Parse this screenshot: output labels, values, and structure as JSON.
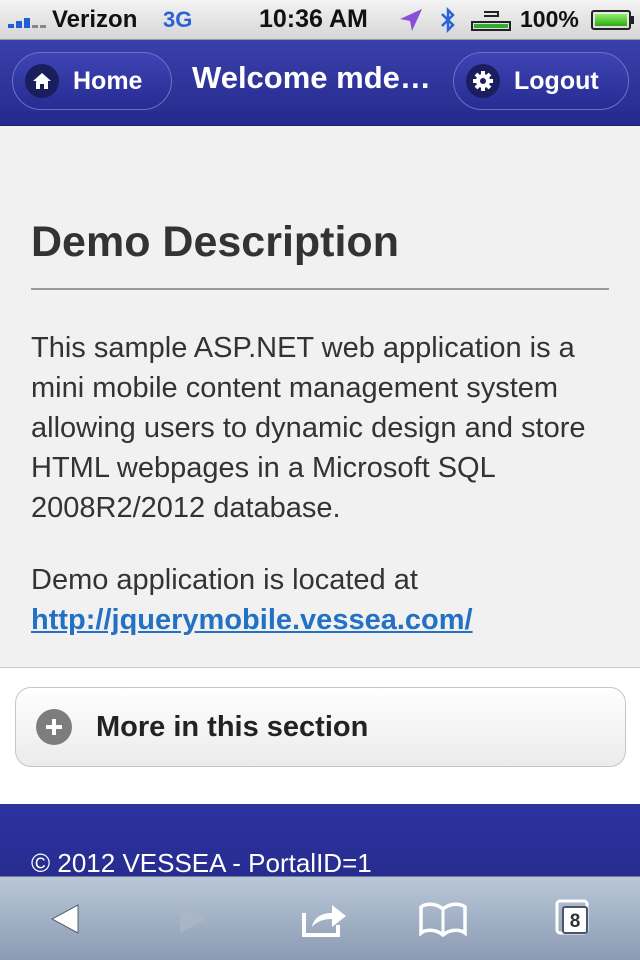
{
  "status_bar": {
    "carrier": "Verizon",
    "network": "3G",
    "time": "10:36 AM",
    "battery": "100%",
    "battery_level": 1.0,
    "icons": [
      "signal-icon",
      "location-icon",
      "bluetooth-icon",
      "dock-icon",
      "battery-icon"
    ]
  },
  "header": {
    "home_label": "Home",
    "title": "Welcome mde…",
    "logout_label": "Logout"
  },
  "content": {
    "heading": "Demo Description",
    "paragraph1": "This sample ASP.NET web application is a mini mobile content management system allowing users to dynamic design and store HTML webpages in a Microsoft SQL 2008R2/2012 database.",
    "paragraph2_text": "Demo application is located at",
    "link": "http://jquerymobile.vessea.com/"
  },
  "collapsible": {
    "label": "More in this section"
  },
  "footer": {
    "copyright": "© 2012 VESSEA - PortalID=1"
  },
  "toolbar": {
    "tabs_count": "8"
  },
  "colors": {
    "header_bg": "#2a3099",
    "link": "#2271c4",
    "content_bg": "#f1f1f1",
    "toolbar_bg": "#a4b2c6"
  }
}
